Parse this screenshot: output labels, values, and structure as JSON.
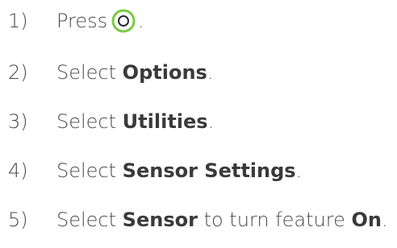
{
  "steps": [
    {
      "num": "1)",
      "text_before": "Press",
      "icon": "o-button-icon",
      "text_after": "."
    },
    {
      "num": "2)",
      "text_before": "Select ",
      "bold": "Options",
      "text_after": "."
    },
    {
      "num": "3)",
      "text_before": "Select ",
      "bold": "Utilities",
      "text_after": "."
    },
    {
      "num": "4)",
      "text_before": "Select ",
      "bold": "Sensor Settings",
      "text_after": "."
    },
    {
      "num": "5)",
      "text_before": "Select ",
      "bold": "Sensor",
      "text_middle": " to turn feature ",
      "bold2": "On",
      "text_after": "."
    }
  ],
  "colors": {
    "text": "#4a4a4a",
    "button_ring": "#7ac943"
  }
}
